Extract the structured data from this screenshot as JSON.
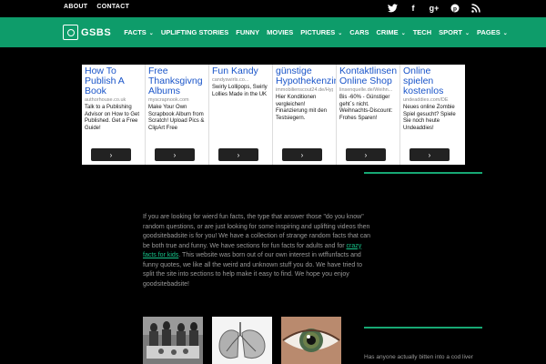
{
  "top": {
    "links": [
      "ABOUT",
      "CONTACT"
    ],
    "social": [
      "twitter-icon",
      "facebook-icon",
      "google-plus-icon",
      "pinterest-icon",
      "rss-icon"
    ]
  },
  "nav": {
    "logo": "GSBS",
    "items": [
      {
        "label": "FACTS",
        "dropdown": true
      },
      {
        "label": "UPLIFTING STORIES",
        "dropdown": false
      },
      {
        "label": "FUNNY",
        "dropdown": false
      },
      {
        "label": "MOVIES",
        "dropdown": false
      },
      {
        "label": "PICTURES",
        "dropdown": true
      },
      {
        "label": "CARS",
        "dropdown": false
      },
      {
        "label": "CRIME",
        "dropdown": true
      },
      {
        "label": "TECH",
        "dropdown": false
      },
      {
        "label": "SPORT",
        "dropdown": true
      },
      {
        "label": "PAGES",
        "dropdown": true
      }
    ]
  },
  "ads": [
    {
      "headline": "How To Publish A Book",
      "source": "authorhouse.co.uk",
      "body": "Talk to a Publishing Advisor on How to Get Published. Get a Free Guide!",
      "button": "›"
    },
    {
      "headline": "Free Thanksgivng Albums",
      "source": "myscrapnook.com",
      "body": "Make Your Own Scrapbook Album from Scratch! Upload Pics & ClipArt Free",
      "button": "›"
    },
    {
      "headline": "Fun Kandy",
      "source": "candyswirls.co...",
      "body": "Swirly Lollipops, Swirly Lollies Made in the UK",
      "button": "›"
    },
    {
      "headline": "günstige Hypothekenzinsen",
      "source": "immobilienscout24.de/Hypot...",
      "body": "Hier Konditionen vergleichen! Finanzierung mit den Testsiegern.",
      "button": "›"
    },
    {
      "headline": "Kontaktlinsen Online Shop",
      "source": "linsenquelle.de/Weihn...",
      "body": "Bis -60% - Günstiger geht´s nicht. Weihnachts-Discount: Frohes Sparen!",
      "button": "›"
    },
    {
      "headline": "Online spielen kostenlos",
      "source": "undeaddies.com/DE",
      "body": "Neues online Zombie Spiel gesucht? Spiele Sie noch heute Undeaddies!",
      "button": "›"
    }
  ],
  "intro": {
    "before_link": "If you are looking for wierd fun facts, the type that answer those \"do you know\" random questions, or are just looking for some inspiring and uplifting videos then goodsitebadsite is for you! We have a collection of strange random facts that can be both true and funny. We have sections for fun facts for adults and for ",
    "link": "crazy facts for kids",
    "after_link": ". This website was born out of our own interest in wtffunfacts and funny quotes, we like all the weird and unknown stuff you do. We have tried to split the site into sections to help make it easy to find. We hope you enjoy goodsitebadsite!"
  },
  "sidebar": {
    "teaser": "Has anyone actually bitten into a cod liver"
  },
  "colors": {
    "accent": "#0e9c6a",
    "link": "#17c48a",
    "ad_headline": "#1a55c9"
  }
}
